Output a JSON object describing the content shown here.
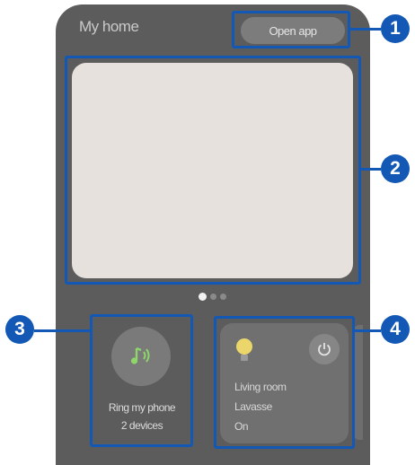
{
  "header": {
    "title": "My home",
    "open_app_label": "Open app"
  },
  "carousel": {
    "page_count": 3,
    "active_page": 1
  },
  "ring_card": {
    "icon": "music-note-icon",
    "line1": "Ring my phone",
    "line2": "2 devices"
  },
  "device_card": {
    "bulb_icon": "light-bulb-icon",
    "power_icon": "power-icon",
    "room": "Living room",
    "name": "Lavasse",
    "status": "On"
  },
  "callouts": [
    "1",
    "2",
    "3",
    "4"
  ],
  "colors": {
    "panel": "#5c5c5c",
    "accent": "#1358b4",
    "note": "#8ed66a",
    "bulb": "#ead66a"
  }
}
